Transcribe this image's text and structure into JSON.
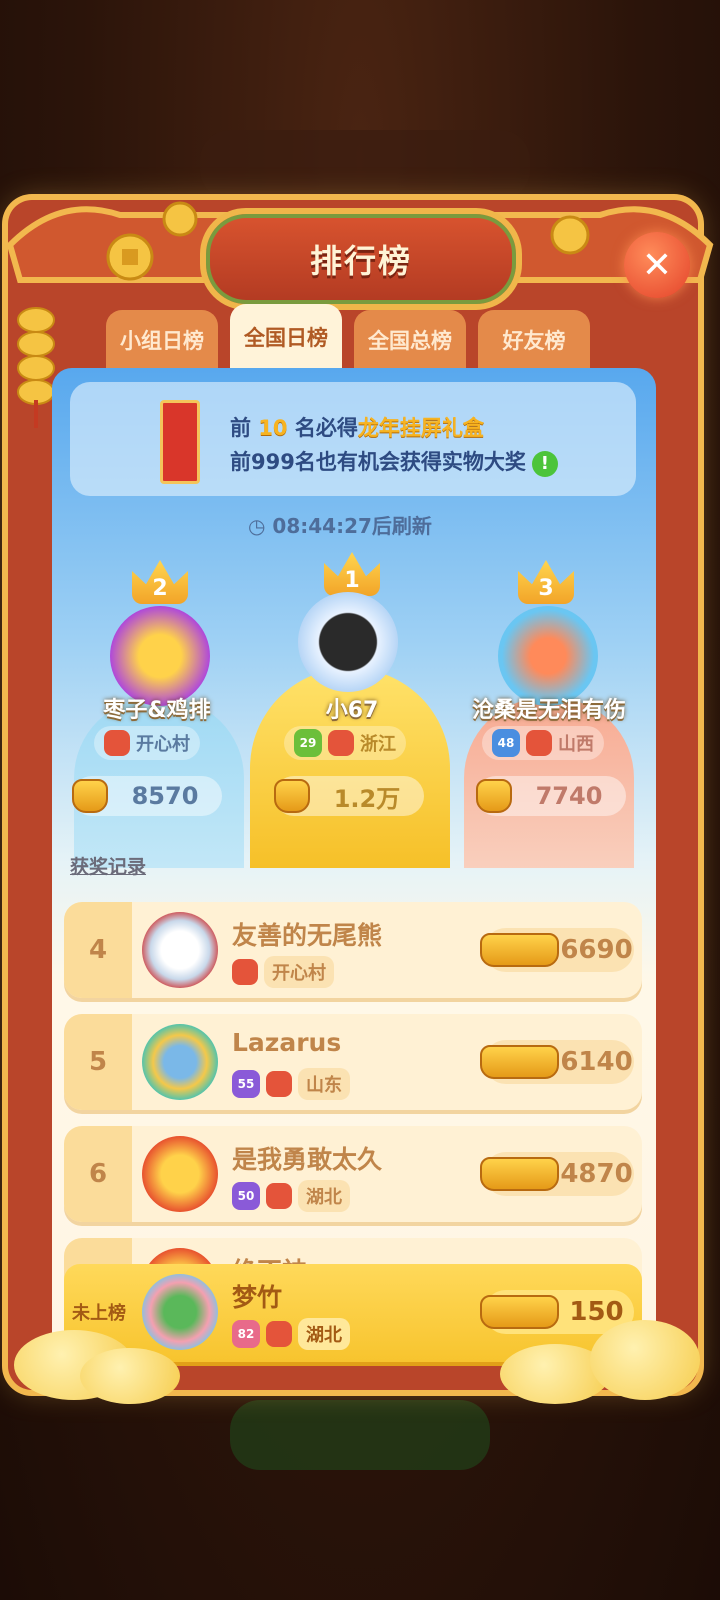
{
  "title": "排行榜",
  "close_icon": "close-icon",
  "tabs": [
    {
      "label": "小组日榜",
      "active": false
    },
    {
      "label": "全国日榜",
      "active": true
    },
    {
      "label": "全国总榜",
      "active": false
    },
    {
      "label": "好友榜",
      "active": false
    }
  ],
  "notice": {
    "line1_prefix": "前 ",
    "line1_num": "10",
    "line1_mid": " 名必得",
    "line1_prize": "龙年挂屏礼盒",
    "line2": "前999名也有机会获得实物大奖",
    "info_icon": "!"
  },
  "refresh_text": "08:44:27后刷新",
  "award_record": "获奖记录",
  "podium": [
    {
      "rank": "2",
      "name": "枣子&鸡排",
      "level": "",
      "location": "开心村",
      "score": "8570"
    },
    {
      "rank": "1",
      "name": "小67",
      "level": "29",
      "location": "浙江",
      "score": "1.2万"
    },
    {
      "rank": "3",
      "name": "沧桑是无泪有伤",
      "level": "48",
      "location": "山西",
      "score": "7740"
    }
  ],
  "rows": [
    {
      "rank": "4",
      "name": "友善的无尾熊",
      "level": "",
      "location": "开心村",
      "score": "6690"
    },
    {
      "rank": "5",
      "name": "Lazarus",
      "level": "55",
      "location": "山东",
      "score": "6140"
    },
    {
      "rank": "6",
      "name": "是我勇敢太久",
      "level": "50",
      "location": "湖北",
      "score": "4870"
    },
    {
      "rank": "",
      "name": "绝不神",
      "level": "",
      "location": "",
      "score": ""
    }
  ],
  "me": {
    "rank": "未上榜",
    "name": "梦竹",
    "level": "82",
    "location": "湖北",
    "score": "150"
  },
  "colors": {
    "frame": "#b9452a",
    "gold": "#f7c42e",
    "sky": "#58a8ee"
  }
}
